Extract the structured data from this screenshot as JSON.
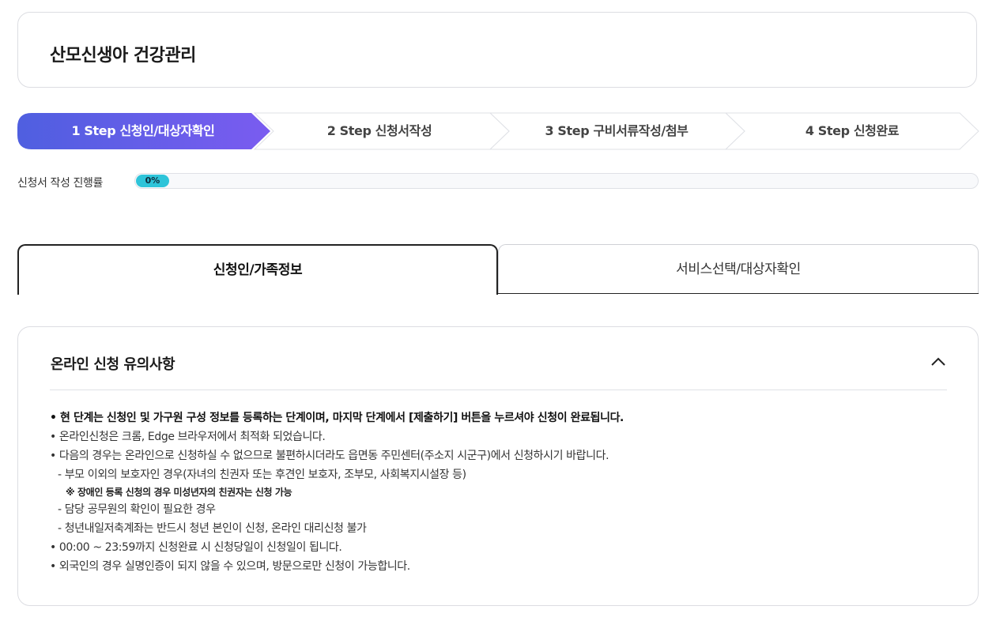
{
  "page": {
    "title": "산모신생아 건강관리"
  },
  "steps": [
    {
      "label": "1 Step 신청인/대상자확인",
      "active": true
    },
    {
      "label": "2 Step 신청서작성",
      "active": false
    },
    {
      "label": "3 Step 구비서류작성/첨부",
      "active": false
    },
    {
      "label": "4 Step 신청완료",
      "active": false
    }
  ],
  "progress": {
    "label": "신청서 작성 진행률",
    "value_text": "0%",
    "value": 0
  },
  "tabs": [
    {
      "label": "신청인/가족정보",
      "active": true
    },
    {
      "label": "서비스선택/대상자확인",
      "active": false
    }
  ],
  "notice": {
    "title": "온라인 신청 유의사항",
    "toggle_icon": "chevron-up-icon",
    "items": [
      "현 단계는 신청인 및 가구원 구성 정보를 등록하는 단계이며, 마지막 단계에서 [제출하기] 버튼을 누르셔야 신청이 완료됩니다.",
      "온라인신청은 크롬, Edge 브라우저에서 최적화 되었습니다.",
      "다음의 경우는 온라인으로 신청하실 수 없으므로 불편하시더라도 읍면동 주민센터(주소지 시군구)에서 신청하시기 바랍니다.",
      "- 부모 이외의 보호자인 경우(자녀의 친권자 또는 후견인 보호자, 조부모, 사회복지시설장 등)",
      "※ 장애인 등록 신청의 경우 미성년자의 친권자는 신청 가능",
      "- 담당 공무원의 확인이 필요한 경우",
      "- 청년내일저축계좌는 반드시 청년 본인이 신청, 온라인 대리신청 불가",
      "00:00 ~ 23:59까지 신청완료 시 신청당일이 신청일이 됩니다.",
      "외국인의 경우 실명인증이 되지 않을 수 있으며, 방문으로만 신청이 가능합니다."
    ]
  },
  "colors": {
    "step_active_start": "#4f5fe0",
    "step_active_end": "#7a5cf0",
    "progress_fill": "#2ec4d9"
  }
}
